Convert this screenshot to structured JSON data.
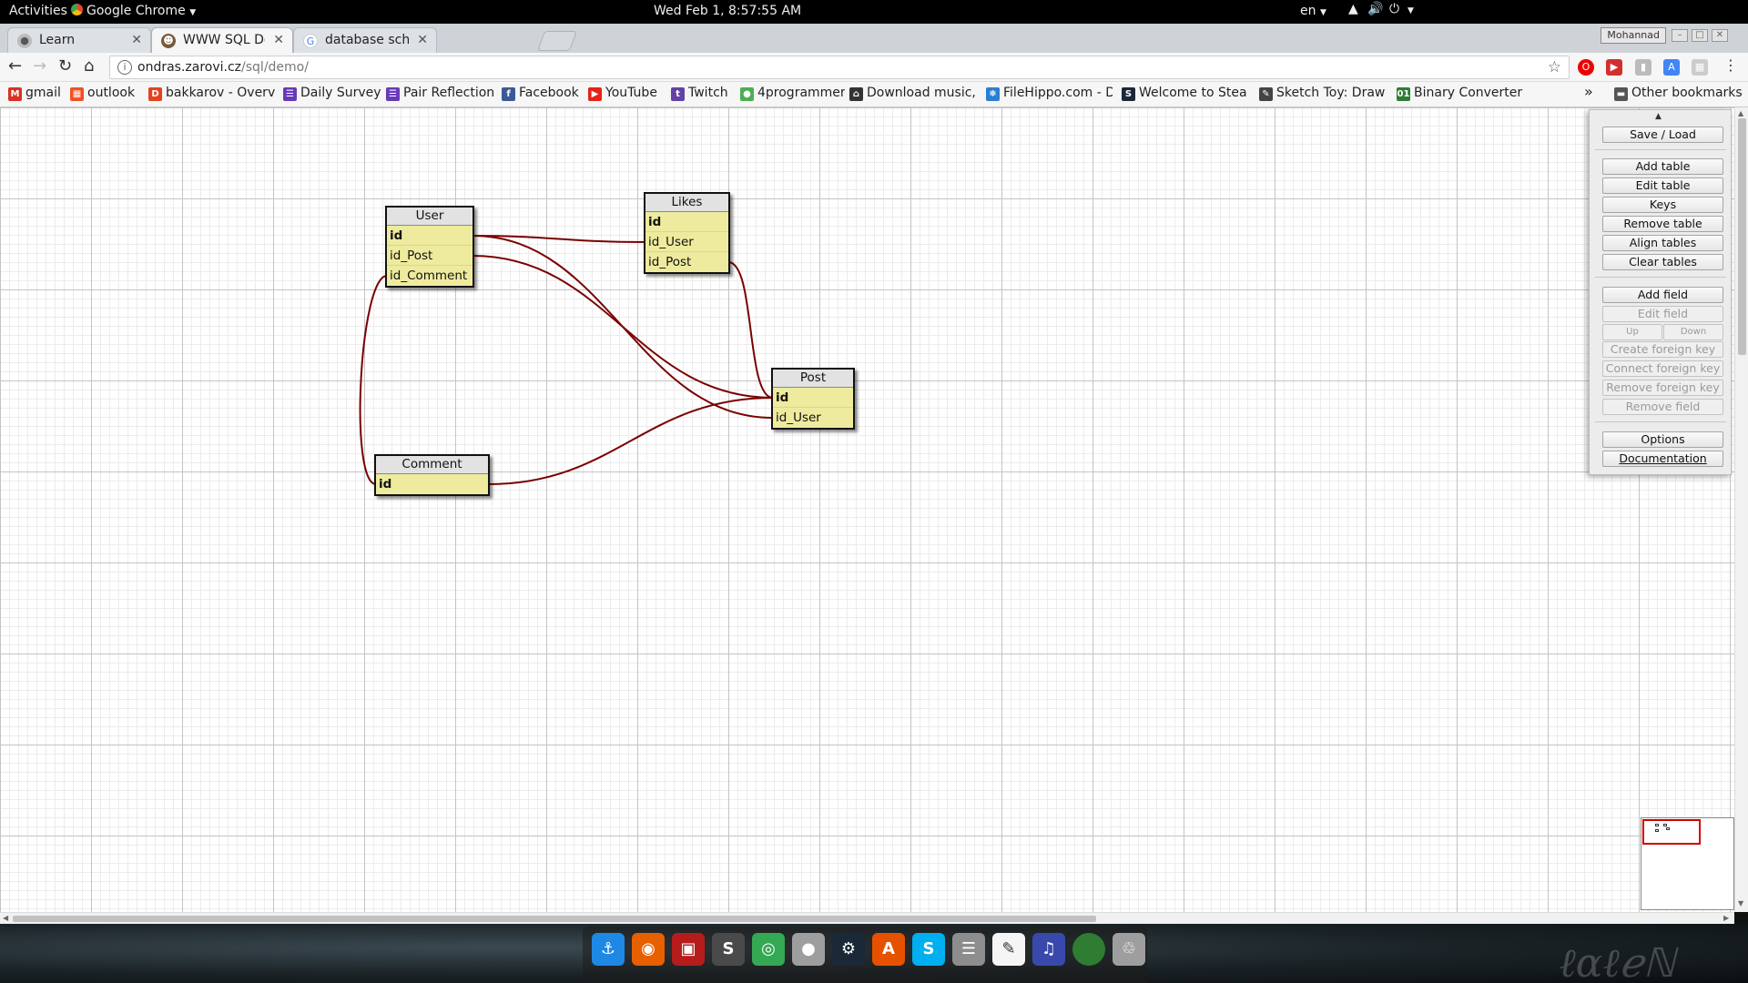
{
  "system_bar": {
    "activities": "Activities",
    "app_menu": "Google Chrome",
    "clock": "Wed Feb  1,  8:57:55 AM",
    "language": "en"
  },
  "browser": {
    "tabs": [
      {
        "label": "Learn",
        "icon": "learn-favicon"
      },
      {
        "label": "WWW SQL Designer",
        "icon": "avatar-favicon"
      },
      {
        "label": "database schema m",
        "icon": "google-favicon"
      }
    ],
    "profile_label": "Mohannad",
    "address": {
      "host": "ondras.zarovi.cz",
      "path": "/sql/demo/"
    },
    "bookmarks": [
      {
        "label": "gmail",
        "icon": "M",
        "color": "#d93025"
      },
      {
        "label": "outlook",
        "icon": "▦",
        "color": "#f25022"
      },
      {
        "label": "bakkarov - Overvi",
        "icon": "D",
        "color": "#e3421f"
      },
      {
        "label": "Daily Survey",
        "icon": "☰",
        "color": "#673ab7"
      },
      {
        "label": "Pair Reflection",
        "icon": "☰",
        "color": "#673ab7"
      },
      {
        "label": "Facebook",
        "icon": "f",
        "color": "#3b5998"
      },
      {
        "label": "YouTube",
        "icon": "▶",
        "color": "#e62117"
      },
      {
        "label": "Twitch",
        "icon": "t",
        "color": "#6441a5"
      },
      {
        "label": "4programmer",
        "icon": "●",
        "color": "#4caf50"
      },
      {
        "label": "Download music,",
        "icon": "⌂",
        "color": "#333333"
      },
      {
        "label": "FileHippo.com - D",
        "icon": "❅",
        "color": "#2a7fd4"
      },
      {
        "label": "Welcome to Stea",
        "icon": "S",
        "color": "#1b2838"
      },
      {
        "label": "Sketch Toy: Draw",
        "icon": "✎",
        "color": "#444444"
      },
      {
        "label": "Binary Converter",
        "icon": "01",
        "color": "#2e7d32"
      }
    ],
    "more_bookmarks": "»",
    "other_bookmarks": "Other bookmarks"
  },
  "designer": {
    "tables": [
      {
        "name": "User",
        "fields": [
          "id",
          "id_Post",
          "id_Comment"
        ]
      },
      {
        "name": "Likes",
        "fields": [
          "id",
          "id_User",
          "id_Post"
        ]
      },
      {
        "name": "Post",
        "fields": [
          "id",
          "id_User"
        ]
      },
      {
        "name": "Comment",
        "fields": [
          "id"
        ]
      }
    ],
    "relations": [
      {
        "from": "User.id",
        "to": "Likes.id_User"
      },
      {
        "from": "User.id",
        "to": "Post.id_User"
      },
      {
        "from": "User.id_Post",
        "to": "Post.id"
      },
      {
        "from": "User.id_Comment",
        "to": "Comment.id"
      },
      {
        "from": "Likes.id_Post",
        "to": "Post.id"
      },
      {
        "from": "Comment.id",
        "to": "Post.id"
      }
    ],
    "relation_color": "#7a0000",
    "panel": {
      "save_load": "Save / Load",
      "add_table": "Add table",
      "edit_table": "Edit table",
      "keys": "Keys",
      "remove_table": "Remove table",
      "align_tables": "Align tables",
      "clear_tables": "Clear tables",
      "add_field": "Add field",
      "edit_field": "Edit field",
      "up": "Up",
      "down": "Down",
      "create_foreign_key": "Create foreign key",
      "connect_foreign_key": "Connect foreign key",
      "remove_foreign_key": "Remove foreign key",
      "remove_field": "Remove field",
      "options": "Options",
      "documentation": "Documentation"
    }
  },
  "dock": {
    "apps": [
      {
        "name": "anchor-icon",
        "glyph": "⚓",
        "color": "#1e88e5"
      },
      {
        "name": "firefox-icon",
        "glyph": "◉",
        "color": "#e66000"
      },
      {
        "name": "terminal-icon",
        "glyph": "▣",
        "color": "#b71c1c"
      },
      {
        "name": "sublime-text-icon",
        "glyph": "S",
        "color": "#4a4a4a"
      },
      {
        "name": "chrome-icon",
        "glyph": "◎",
        "color": "#34a853"
      },
      {
        "name": "disk-utility-icon",
        "glyph": "●",
        "color": "#9e9e9e"
      },
      {
        "name": "steam-icon",
        "glyph": "⚙",
        "color": "#1b2838"
      },
      {
        "name": "software-center-icon",
        "glyph": "A",
        "color": "#e65100"
      },
      {
        "name": "skype-icon",
        "glyph": "S",
        "color": "#00aff0"
      },
      {
        "name": "files-icon",
        "glyph": "☰",
        "color": "#8d8d8d"
      },
      {
        "name": "text-editor-icon",
        "glyph": "✎",
        "color": "#f5f5f5"
      },
      {
        "name": "music-icon",
        "glyph": "♫",
        "color": "#3949ab"
      },
      {
        "name": "green-orb-icon",
        "glyph": "",
        "color": "#2e7d32"
      },
      {
        "name": "trash-icon",
        "glyph": "♲",
        "color": "#9e9e9e"
      }
    ]
  }
}
